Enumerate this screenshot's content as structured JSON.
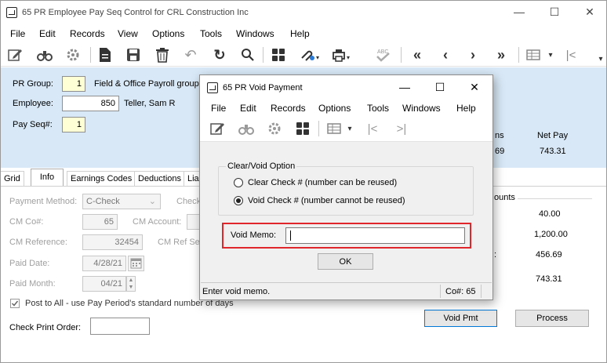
{
  "main": {
    "title": "65 PR Employee Pay Seq Control for CRL Construction Inc",
    "window_controls": {
      "minimize": "—",
      "maximize": "☐",
      "close": "✕"
    },
    "menu": [
      "File",
      "Edit",
      "Records",
      "View",
      "Options",
      "Tools",
      "Windows",
      "Help"
    ],
    "toolbar_icons": [
      "edit-icon",
      "binoculars-icon",
      "gear-icon",
      "document-icon",
      "save-icon",
      "delete-icon",
      "undo-icon",
      "refresh-icon",
      "search-icon",
      "grid-icon",
      "attach-icon",
      "print-icon",
      "spellcheck-icon",
      "first-record-icon",
      "previous-record-icon",
      "next-record-icon",
      "last-record-icon",
      "grid-options-icon",
      "first-icon"
    ],
    "toolbar_glyphs": {
      "first": "«",
      "prev": "‹",
      "next": "›",
      "last": "»",
      "dropdown": "▾",
      "start": "|<",
      "scroll": "▾"
    },
    "header": {
      "pr_group_label": "PR Group:",
      "pr_group_value": "1",
      "pr_group_desc": "Field & Office Payroll group",
      "employee_label": "Employee:",
      "employee_value": "850",
      "employee_name": "Teller, Sam R",
      "pay_seq_label": "Pay Seq#:",
      "pay_seq_value": "1",
      "col_partial": "ns",
      "col_value_partial": "69",
      "net_pay_label": "Net Pay",
      "net_pay_value": "743.31"
    },
    "tabs": [
      "Grid",
      "Info",
      "Earnings Codes",
      "Deductions",
      "Lia"
    ],
    "active_tab": "Info",
    "info": {
      "payment_method_label": "Payment Method:",
      "payment_method_value": "C-Check",
      "check_partial": "Check",
      "cm_co_label": "CM Co#:",
      "cm_co_value": "65",
      "cm_account_label": "CM Account:",
      "cm_reference_label": "CM Reference:",
      "cm_reference_value": "32454",
      "cm_ref_seq_label": "CM Ref Seq",
      "paid_date_label": "Paid Date:",
      "paid_date_value": "4/28/21",
      "paid_month_label": "Paid Month:",
      "paid_month_value": "04/21",
      "post_to_all_label": "Post to All - use Pay Period's standard number of days",
      "check_print_order_label": "Check Print Order:",
      "check_print_order_value": ""
    },
    "amounts": {
      "group_label_partial": "ounts",
      "values": [
        "40.00",
        "1,200.00",
        "456.69",
        "743.31"
      ],
      "colon": ":"
    },
    "buttons": {
      "void_pmt": "Void Pmt",
      "process": "Process"
    }
  },
  "dialog": {
    "title": "65 PR Void Payment",
    "window_controls": {
      "minimize": "—",
      "maximize": "☐",
      "close": "✕"
    },
    "menu": [
      "File",
      "Edit",
      "Records",
      "Options",
      "Tools",
      "Windows",
      "Help"
    ],
    "toolbar_icons": [
      "edit-icon",
      "binoculars-icon",
      "gear-icon",
      "grid-icon",
      "grid-options-icon",
      "first-icon",
      "last-icon"
    ],
    "toolbar_glyphs": {
      "dropdown": "▾",
      "first": "|<",
      "last": ">|"
    },
    "group_label": "Clear/Void Option",
    "option_clear": "Clear Check # (number can be reused)",
    "option_void": "Void Check #  (number cannot be reused)",
    "selected_option": "void",
    "void_memo_label": "Void Memo:",
    "void_memo_value": "",
    "ok_label": "OK",
    "status_text": "Enter void memo.",
    "status_co": "Co#: 65"
  }
}
